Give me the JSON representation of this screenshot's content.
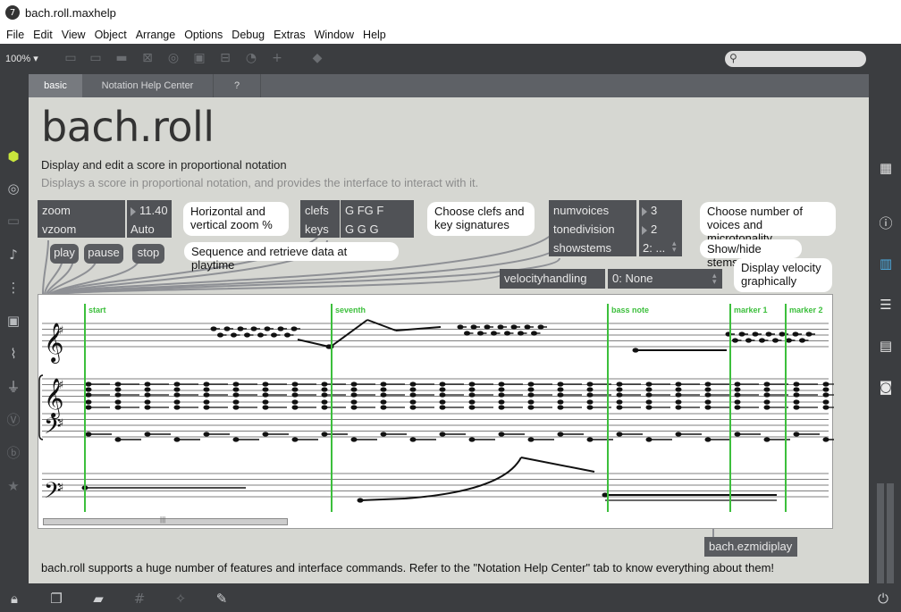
{
  "window": {
    "title": "bach.roll.maxhelp",
    "app_icon": "7"
  },
  "menu": [
    "File",
    "Edit",
    "View",
    "Object",
    "Arrange",
    "Options",
    "Debug",
    "Extras",
    "Window",
    "Help"
  ],
  "toolbar": {
    "zoom": "100% ▾"
  },
  "tabs": {
    "basic": "basic",
    "notation": "Notation Help Center",
    "question": "?"
  },
  "header": {
    "title": "bach.roll",
    "subtitle": "Display and edit a score in proportional notation",
    "description": "Displays a score in proportional notation, and provides the interface to interact with it."
  },
  "attrs": {
    "zoom_label": "zoom",
    "zoom_value": "11.40",
    "vzoom_label": "vzoom",
    "vzoom_value": "Auto",
    "clefs_label": "clefs",
    "clefs_value": "G FG F",
    "keys_label": "keys",
    "keys_value": "G G G",
    "numvoices_label": "numvoices",
    "numvoices_value": "3",
    "tonedivision_label": "tonedivision",
    "tonedivision_value": "2",
    "showstems_label": "showstems",
    "showstems_value": "2: ...",
    "velocity_label": "velocityhandling",
    "velocity_value": "0: None"
  },
  "messages": {
    "play": "play",
    "pause": "pause",
    "stop": "stop"
  },
  "comments": {
    "zoom_line1": "Horizontal and",
    "zoom_line2": "vertical zoom %",
    "clefs_line1": "Choose clefs and",
    "clefs_line2": "key signatures",
    "seq": "Sequence and retrieve data at playtime",
    "voices_line1": "Choose number of",
    "voices_line2": "voices and microtonality",
    "stems": "Show/hide stems",
    "velocity_line1": "Display velocity",
    "velocity_line2": "graphically"
  },
  "markers": [
    "start",
    "seventh",
    "bass note",
    "marker 1",
    "marker 2"
  ],
  "score": {
    "marker_color": "#3cbf3c",
    "scrollbar_label": "|||"
  },
  "ezmidiplay": "bach.ezmidiplay",
  "footer_text": "bach.roll supports a huge number of features and interface commands. Refer to the \"Notation Help Center\" tab to know everything about them!"
}
